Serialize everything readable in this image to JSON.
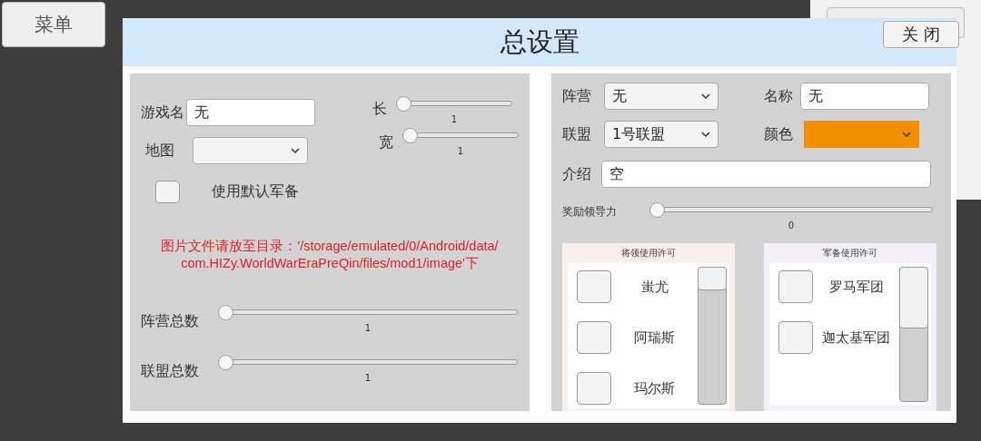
{
  "menu_button": "菜单",
  "dialog": {
    "title": "总设置",
    "close_button": "关 闭",
    "game": {
      "name_label": "游戏名",
      "name_value": "无",
      "map_label": "地图",
      "size_sliders": [
        {
          "label": "长",
          "level": 0,
          "reading": "1"
        },
        {
          "label": "宽",
          "level": 0,
          "reading": "1"
        }
      ],
      "default_armament": {
        "label": "使用默认军备",
        "checked": false
      },
      "notice": "图片文件请放至目录：'/storage/emulated/0/Android/data/ com.HIZy.WorldWarEraPreQin/files/mod1/image'下",
      "count_sliders": [
        {
          "label": "阵营总数",
          "level": 0,
          "reading": "1"
        },
        {
          "label": "联盟总数",
          "level": 0,
          "reading": "1"
        }
      ]
    },
    "faction": {
      "camp_label": "阵营",
      "camp_value": "无",
      "name_label": "名称",
      "name_value": "无",
      "alliance_label": "联盟",
      "alliance_value": "1号联盟",
      "color_label": "颜色",
      "color": "#f39200",
      "intro_label": "介绍",
      "intro_value": "空",
      "reward": {
        "label": "奖励领导力",
        "level": 0,
        "reading": "0"
      },
      "lists": [
        {
          "title": "将领使用许可",
          "color": "#fbefec",
          "items": [
            {
              "name": "蚩尤",
              "checked": false
            },
            {
              "name": "阿瑞斯",
              "checked": false
            },
            {
              "name": "玛尔斯",
              "checked": false
            }
          ]
        },
        {
          "title": "军备使用许可",
          "color": "#f3f0fb",
          "items": [
            {
              "name": "罗马军团",
              "checked": false
            },
            {
              "name": "迦太基军团",
              "checked": false
            }
          ]
        }
      ]
    }
  }
}
